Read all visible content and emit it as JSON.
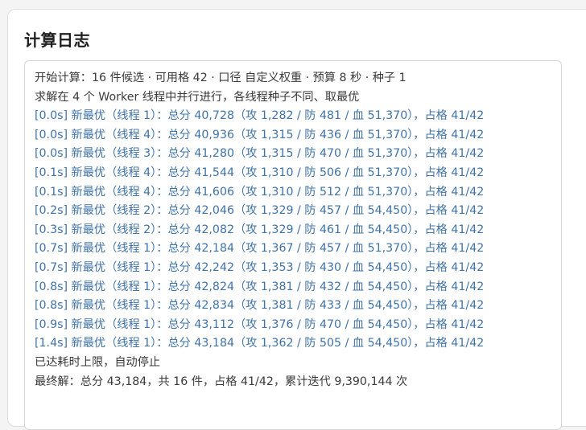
{
  "panel": {
    "title": "计算日志"
  },
  "log": {
    "header_lines": [
      "开始计算：16 件候选 · 可用格 42 · 口径 自定义权重 · 预算 8 秒 · 种子 1",
      "求解在 4 个 Worker 线程中并行进行，各线程种子不同、取最优"
    ],
    "improvements": [
      "[0.0s] 新最优（线程 1）：总分 40,728（攻 1,282 / 防 481 / 血 51,370），占格 41/42",
      "[0.0s] 新最优（线程 4）：总分 40,936（攻 1,315 / 防 436 / 血 51,370），占格 41/42",
      "[0.0s] 新最优（线程 3）：总分 41,280（攻 1,315 / 防 470 / 血 51,370），占格 41/42",
      "[0.1s] 新最优（线程 4）：总分 41,544（攻 1,310 / 防 506 / 血 51,370），占格 41/42",
      "[0.1s] 新最优（线程 4）：总分 41,606（攻 1,310 / 防 512 / 血 51,370），占格 41/42",
      "[0.2s] 新最优（线程 2）：总分 42,046（攻 1,329 / 防 457 / 血 54,450），占格 41/42",
      "[0.3s] 新最优（线程 2）：总分 42,082（攻 1,329 / 防 461 / 血 54,450），占格 41/42",
      "[0.7s] 新最优（线程 1）：总分 42,184（攻 1,367 / 防 457 / 血 51,370），占格 41/42",
      "[0.7s] 新最优（线程 1）：总分 42,242（攻 1,353 / 防 430 / 血 54,450），占格 41/42",
      "[0.8s] 新最优（线程 1）：总分 42,824（攻 1,381 / 防 432 / 血 54,450），占格 41/42",
      "[0.8s] 新最优（线程 1）：总分 42,834（攻 1,381 / 防 433 / 血 54,450），占格 41/42",
      "[0.9s] 新最优（线程 1）：总分 43,112（攻 1,376 / 防 470 / 血 54,450），占格 41/42",
      "[1.4s] 新最优（线程 1）：总分 43,184（攻 1,362 / 防 505 / 血 54,450），占格 41/42"
    ],
    "footer_lines": [
      "已达耗时上限，自动停止",
      "最终解：总分 43,184，共 16 件，占格 41/42，累计迭代 9,390,144 次"
    ]
  },
  "colors": {
    "info_text": "#3a3a3a",
    "improvement_text": "#3f73a8"
  }
}
